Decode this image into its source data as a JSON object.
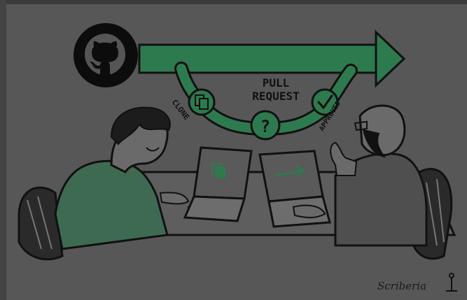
{
  "illustration": {
    "labels": {
      "pull_request_line1": "PULL",
      "pull_request_line2": "REQUEST",
      "clone": "CLONE",
      "approved": "APPROVED",
      "question": "?",
      "signature": "Scriberia"
    },
    "icons": {
      "logo": "github-logo-icon",
      "clone": "copy-icon",
      "approved": "checkmark-icon",
      "laptop_left": "copy-icon",
      "laptop_right": "arrow-right-icon"
    },
    "colors": {
      "background": "#575757",
      "accent_green": "#2e7a4f",
      "ink": "#111111",
      "skin": "#6a6a6a",
      "left_shirt": "#3f6a52"
    }
  }
}
